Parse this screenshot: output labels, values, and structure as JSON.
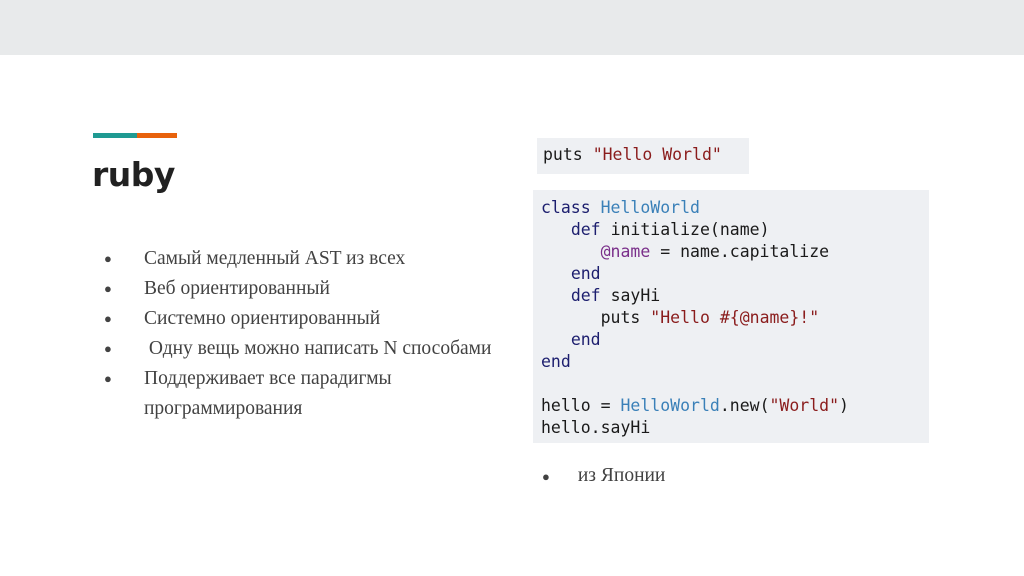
{
  "slide": {
    "title": "ruby",
    "bullets": [
      "Самый медленный AST из всех",
      "Веб ориентированный",
      "Системно ориентированный",
      " Одну вещь можно написать N способами",
      "Поддерживает все парадигмы программирования"
    ],
    "side_bullet": "из Японии",
    "bullet_glyph": "●"
  },
  "colors": {
    "accent_teal": "#1f9a92",
    "accent_orange": "#e8620c",
    "title": "#212121",
    "code_bg": "#eef0f3"
  },
  "code_block_1": {
    "method": "puts",
    "string": "\"Hello World\""
  },
  "code_block_2": {
    "class_kw": "class",
    "class_name": "HelloWorld",
    "def_kw_1": "def",
    "init_sig": "initialize(name)",
    "ivar": "@name",
    "assign_rest": "= name.capitalize",
    "end_1": "end",
    "def_kw_2": "def",
    "say_sig": "sayHi",
    "puts_call": "puts",
    "say_string": "\"Hello #{@name}!\"",
    "end_2": "end",
    "end_3": "end",
    "hello_var": "hello =",
    "hello_class": "HelloWorld",
    "new_call": ".new(",
    "world_string": "\"World\"",
    "close_paren": ")",
    "say_call": "hello.sayHi"
  }
}
